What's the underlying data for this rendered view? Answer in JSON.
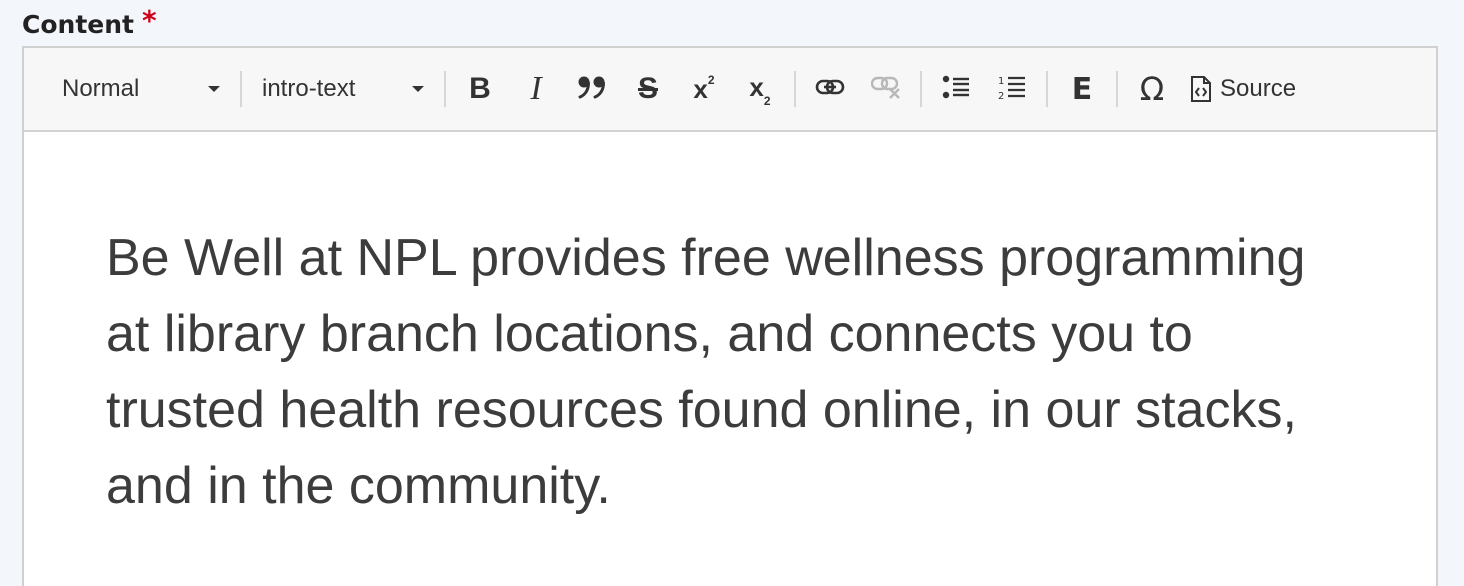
{
  "field": {
    "label": "Content",
    "required_mark": "*"
  },
  "toolbar": {
    "style_dropdown": {
      "value": "Normal"
    },
    "class_dropdown": {
      "value": "intro-text"
    },
    "buttons": {
      "bold": "B",
      "italic": "I",
      "blockquote": "”",
      "strikethrough": "S",
      "superscript_base": "x",
      "superscript_mark": "2",
      "subscript_base": "x",
      "subscript_mark": "2",
      "emphasis": "E",
      "special_char": "Ω",
      "source": "Source"
    },
    "icons": [
      "bold-icon",
      "italic-icon",
      "blockquote-icon",
      "strikethrough-icon",
      "superscript-icon",
      "subscript-icon",
      "link-icon",
      "unlink-icon",
      "bulleted-list-icon",
      "numbered-list-icon",
      "emphasis-icon",
      "omega-icon",
      "source-icon"
    ]
  },
  "editor": {
    "paragraph": "Be Well at NPL provides free wellness programming at library branch locations, and connects you to trusted health resources found online, in our stacks, and in the community."
  },
  "colors": {
    "required": "#d0021b",
    "text": "#3c3c3c",
    "toolbar_bg": "#f7f7f7",
    "disabled_icon": "#b8b8b8"
  }
}
